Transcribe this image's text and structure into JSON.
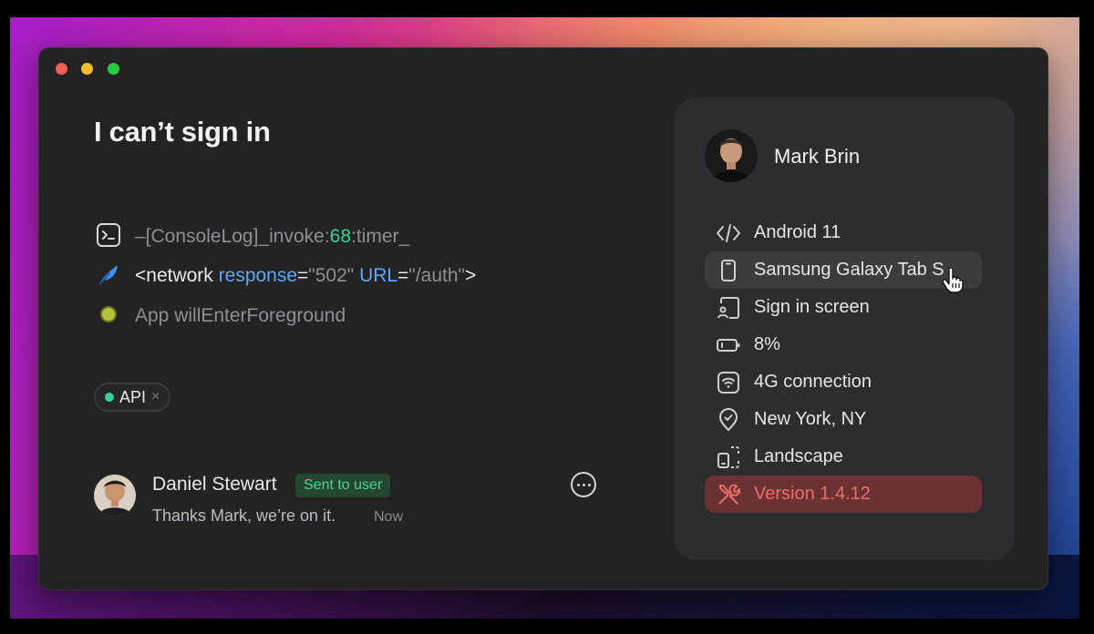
{
  "window": {
    "title": "I can’t sign in"
  },
  "logs": [
    {
      "icon": "terminal-icon",
      "prefix": "–[ConsoleLog]_invoke:",
      "number": "68",
      "suffix": ":timer_"
    },
    {
      "icon": "feather-icon",
      "open": "<network ",
      "attr1": "response",
      "eq1": "=",
      "val1": "\"502\"",
      "attr2": " URL",
      "eq2": "=",
      "val2": "\"/auth\"",
      "close": ">"
    },
    {
      "icon": "status-dot-icon",
      "text": "App willEnterForeground"
    }
  ],
  "tag": {
    "label": "API",
    "remove": "×"
  },
  "comment": {
    "author": "Daniel Stewart",
    "badge": "Sent to user",
    "text": "Thanks Mark, we’re on it.",
    "time": "Now"
  },
  "panel": {
    "user_name": "Mark Brin",
    "items": [
      {
        "icon": "code-icon",
        "label": "Android 11"
      },
      {
        "icon": "phone-icon",
        "label": "Samsung Galaxy Tab S"
      },
      {
        "icon": "screen-icon",
        "label": "Sign in screen"
      },
      {
        "icon": "battery-icon",
        "label": "8%"
      },
      {
        "icon": "wifi-icon",
        "label": "4G connection"
      },
      {
        "icon": "location-icon",
        "label": "New York, NY"
      },
      {
        "icon": "rotate-icon",
        "label": "Landscape"
      },
      {
        "icon": "tools-icon",
        "label": "Version 1.4.12"
      }
    ]
  },
  "colors": {
    "accent_green": "#34d399",
    "accent_blue": "#5fa8f5",
    "danger": "#f06c6c",
    "danger_bg": "#6a3232"
  }
}
